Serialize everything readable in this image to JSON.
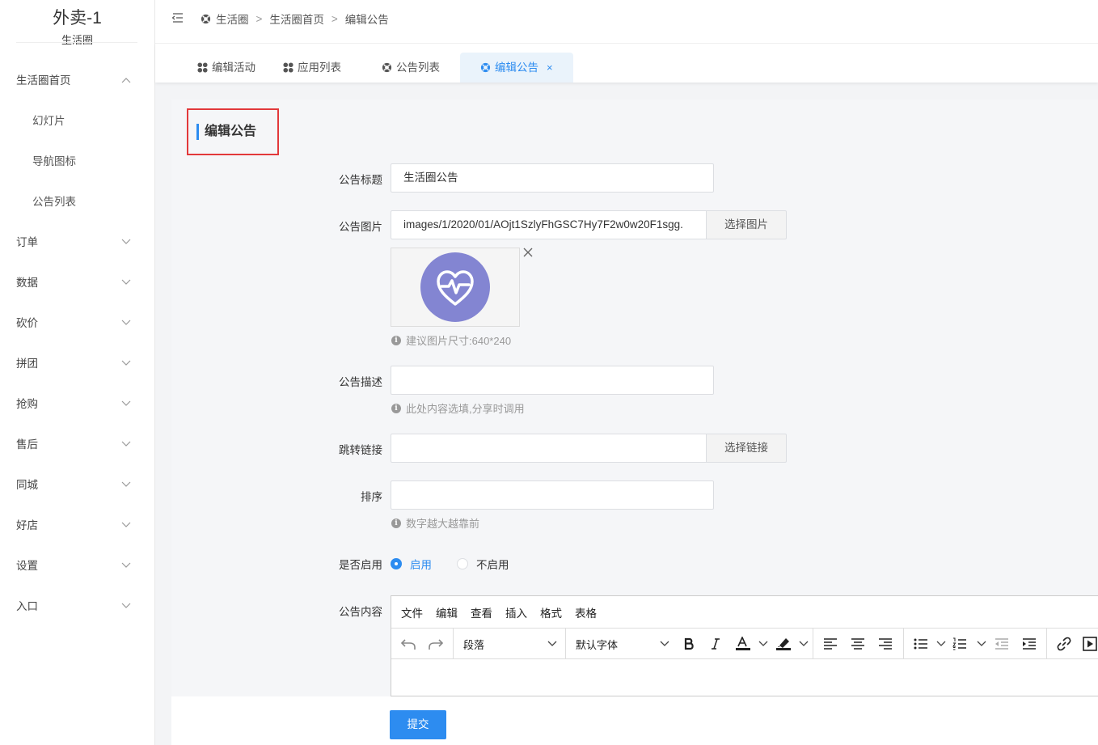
{
  "brand": {
    "title": "外卖-1",
    "subtitle": "生活圈"
  },
  "sidebar": {
    "items": [
      {
        "label": "生活圈首页",
        "expanded": true
      },
      {
        "label": "幻灯片"
      },
      {
        "label": "导航图标"
      },
      {
        "label": "公告列表"
      },
      {
        "label": "订单"
      },
      {
        "label": "数据"
      },
      {
        "label": "砍价"
      },
      {
        "label": "拼团"
      },
      {
        "label": "抢购"
      },
      {
        "label": "售后"
      },
      {
        "label": "同城"
      },
      {
        "label": "好店"
      },
      {
        "label": "设置"
      },
      {
        "label": "入口"
      }
    ]
  },
  "breadcrumb": {
    "items": [
      "生活圈",
      "生活圈首页",
      "编辑公告"
    ],
    "separator": ">"
  },
  "tabs": [
    {
      "label": "编辑活动",
      "icon": "apps-icon"
    },
    {
      "label": "应用列表",
      "icon": "apps-icon"
    },
    {
      "label": "公告列表",
      "icon": "lifebuoy-icon"
    },
    {
      "label": "编辑公告",
      "icon": "lifebuoy-icon",
      "active": true,
      "close": "×"
    }
  ],
  "form": {
    "section_title": "编辑公告",
    "title": {
      "label": "公告标题",
      "value": "生活圈公告"
    },
    "image": {
      "label": "公告图片",
      "value": "images/1/2020/01/AOjt1SzlyFhGSC7Hy7F2w0w20F1sgg.",
      "button": "选择图片",
      "hint": "建议图片尺寸:640*240"
    },
    "description": {
      "label": "公告描述",
      "value": "",
      "hint": "此处内容选填,分享时调用"
    },
    "link": {
      "label": "跳转链接",
      "value": "",
      "button": "选择链接"
    },
    "sort": {
      "label": "排序",
      "value": "",
      "hint": "数字越大越靠前"
    },
    "enabled": {
      "label": "是否启用",
      "options": [
        "启用",
        "不启用"
      ],
      "selected": "启用"
    },
    "content": {
      "label": "公告内容",
      "menubar": [
        "文件",
        "编辑",
        "查看",
        "插入",
        "格式",
        "表格"
      ],
      "block_format": "段落",
      "font_family": "默认字体"
    },
    "submit": "提交"
  },
  "colors": {
    "accent": "#2d8cf0",
    "highlight_border": "#e2393b",
    "thumb_bg": "#8385d2"
  }
}
